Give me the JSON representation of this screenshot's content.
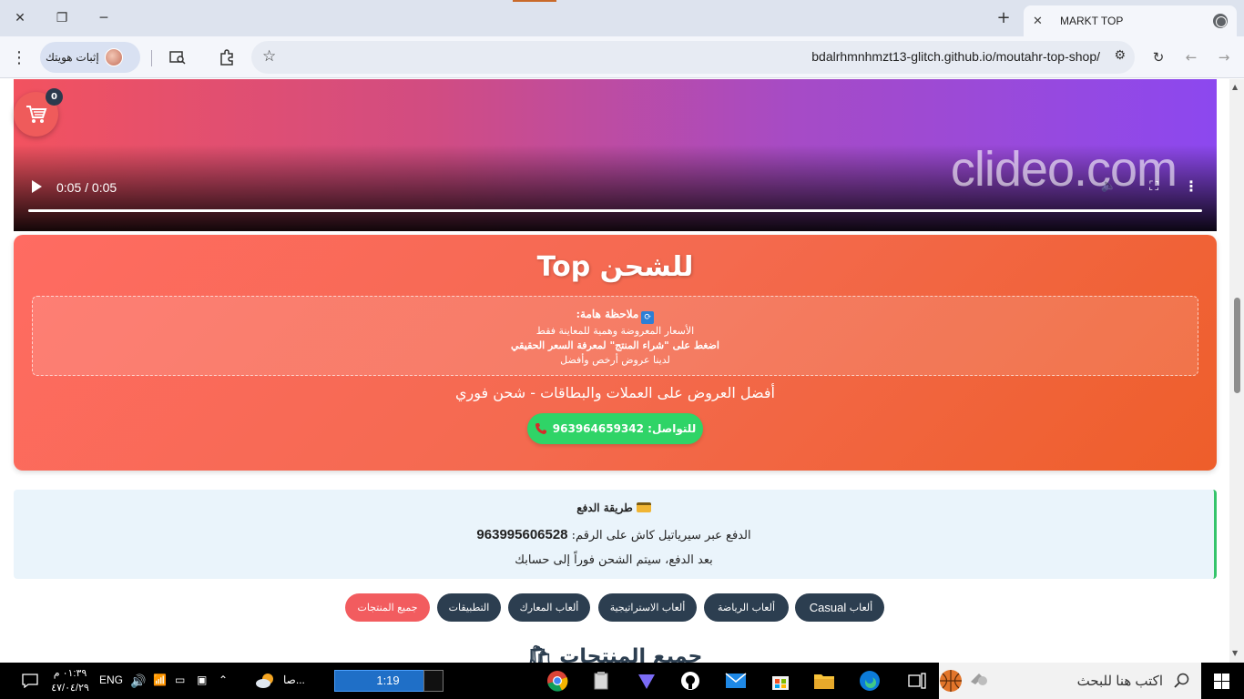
{
  "browser": {
    "tab_title": "MARKT TOP",
    "url": "bdalrhmnhmzt13-glitch.github.io/moutahr-top-shop/",
    "profile_label": "إثبات هويتك"
  },
  "video": {
    "time": "0:05 / 0:05",
    "watermark": "clideo.com",
    "progress_fraction": 1.0
  },
  "cart": {
    "count": "0"
  },
  "hero": {
    "title": "للشحن Top",
    "notice_title": "ملاحظة هامة:",
    "notice_lines": [
      "الأسعار المعروضة وهمية للمعاينة فقط",
      "اضغط على \"شراء المنتج\" لمعرفة السعر الحقيقي",
      "لدينا عروض أرخص وأفضل"
    ],
    "subtitle": "أفضل العروض على العملات والبطاقات - شحن فوري",
    "contact_label": "للتواصل: 963964659342"
  },
  "payment": {
    "title": "طريقة الدفع",
    "method_text": "الدفع عبر سيرياتيل كاش على الرقم:",
    "number": "963995606528",
    "after_text": "بعد الدفع، سيتم الشحن فوراً إلى حسابك"
  },
  "filters": [
    {
      "label": "ألعاب",
      "latin": "Casual",
      "active": false
    },
    {
      "label": "ألعاب الرياضة",
      "active": false
    },
    {
      "label": "ألعاب الاستراتيجية",
      "active": false
    },
    {
      "label": "ألعاب المعارك",
      "active": false
    },
    {
      "label": "التطبيقات",
      "active": false
    },
    {
      "label": "جميع المنتجات",
      "active": true
    }
  ],
  "section_title": "جميع المنتجات",
  "taskbar": {
    "search_placeholder": "اكتب هنا للبحث",
    "media_time": "1:19",
    "language": "ENG",
    "weather_label": "صا...",
    "clock_time": "٠١:٣٩ م",
    "clock_date": "٤٧/٠٤/٢٩"
  },
  "colors": {
    "accent_red": "#f25c5f",
    "navy": "#2c3e50",
    "whatsapp_green": "#2fd467",
    "hero_gradient_start": "#ff6b62",
    "hero_gradient_end": "#ee5e2a"
  }
}
